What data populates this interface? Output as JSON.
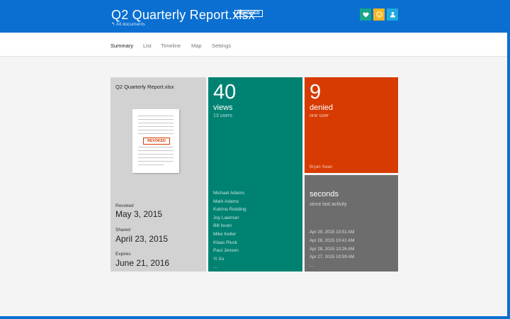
{
  "header": {
    "title": "Q2 Quarterly Report.xlsx",
    "badge": "REVOKED",
    "breadcrumb": "All documents",
    "buttons": [
      {
        "icon": "heart-icon",
        "color": "#17a78a"
      },
      {
        "icon": "smiley-icon",
        "color": "#f3b61e"
      },
      {
        "icon": "person-icon",
        "color": "#1fa9e0"
      }
    ]
  },
  "nav": {
    "tabs": [
      {
        "label": "Summary",
        "active": true
      },
      {
        "label": "List",
        "active": false
      },
      {
        "label": "Timeline",
        "active": false
      },
      {
        "label": "Map",
        "active": false
      },
      {
        "label": "Settings",
        "active": false
      }
    ]
  },
  "document": {
    "name": "Q2 Quarterly Report.xlsx",
    "stamp": "REVOKED",
    "revoked_label": "Revoked",
    "revoked_date": "May 3, 2015",
    "shared_label": "Shared",
    "shared_date": "April 23, 2015",
    "expires_label": "Expires",
    "expires_date": "June 21, 2016"
  },
  "views": {
    "count": "40",
    "label": "views",
    "sub": "13 users",
    "users": [
      "Michael Adams",
      "Mark Adams",
      "Katrina Redding",
      "Joy Lawman",
      "Bill Isvan",
      "Mike Keller",
      "Klaas Pluck",
      "Paul Jensen",
      "Yi Xu",
      "..."
    ]
  },
  "denied": {
    "count": "9",
    "label": "denied",
    "sub": "one user",
    "user": "Bryan Swan"
  },
  "seconds": {
    "label": "seconds",
    "sub": "since last activity",
    "activity": [
      "Apr 29, 2015 10:51 AM",
      "Apr 28, 2015 10:41 AM",
      "Apr 28, 2015 10:26 AM",
      "Apr 27, 2015 10:59 AM",
      "..."
    ]
  },
  "colors": {
    "header": "#0a6fd1",
    "views": "#008272",
    "denied": "#d83b01",
    "seconds": "#6d6d6d",
    "document": "#d2d2d2"
  }
}
